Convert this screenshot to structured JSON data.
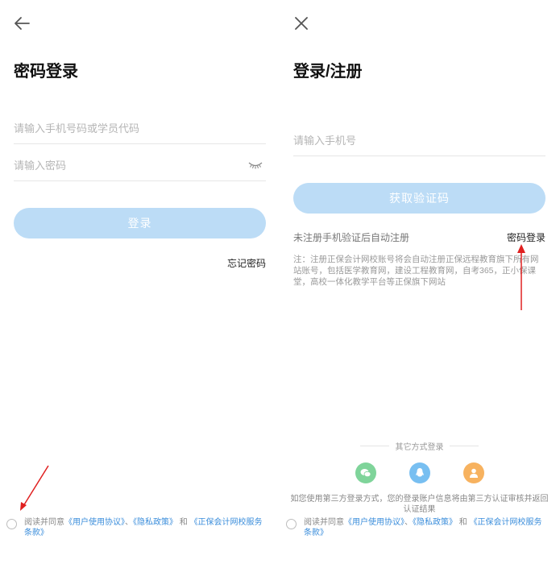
{
  "left": {
    "title": "密码登录",
    "account_placeholder": "请输入手机号码或学员代码",
    "password_placeholder": "请输入密码",
    "login_button": "登录",
    "forgot_password": "忘记密码",
    "agreement": {
      "prefix": "阅读并同意",
      "user_agreement": "《用户使用协议》",
      "sep": "、",
      "privacy": "《隐私政策》",
      "and": "和",
      "service_terms": "《正保会计网校服务条款》"
    },
    "back_icon": "arrow-left-icon",
    "eye_icon": "eye-closed-icon"
  },
  "right": {
    "title": "登录/注册",
    "phone_placeholder": "请输入手机号",
    "get_code_button": "获取验证码",
    "auto_register_hint": "未注册手机验证后自动注册",
    "password_login_link": "密码登录",
    "note": "注：注册正保会计网校账号将会自动注册正保远程教育旗下所有网站账号，包括医学教育网，建设工程教育网，自考365，正小保课堂，高校一体化教学平台等正保旗下网站",
    "other_methods": "其它方式登录",
    "third_party_note": "如您使用第三方登录方式，您的登录账户信息将由第三方认证审核并返回认证结果",
    "agreement": {
      "prefix": "阅读并同意",
      "user_agreement": "《用户使用协议》",
      "sep": "、",
      "privacy": "《隐私政策》",
      "and": "和",
      "service_terms": "《正保会计网校服务条款》"
    },
    "close_icon": "close-icon",
    "social_icons": [
      "wechat-icon",
      "qq-icon",
      "user-icon"
    ]
  },
  "colors": {
    "button_disabled": "#bcdcf6",
    "link": "#3a8ddb",
    "wechat": "#7fd49a",
    "qq": "#78bff1",
    "user": "#f7b25f",
    "annotation_arrow": "#e02020"
  }
}
